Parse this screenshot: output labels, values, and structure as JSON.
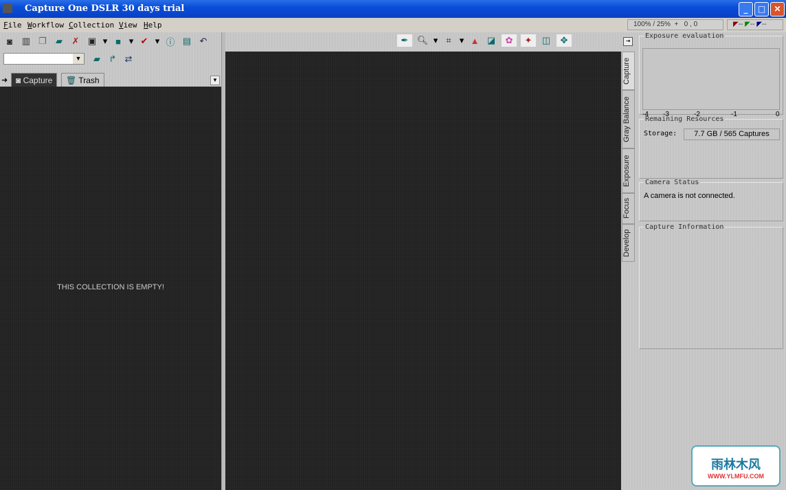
{
  "window": {
    "title": "Capture One DSLR 30 days trial"
  },
  "menu": [
    "File",
    "Workflow",
    "Collection",
    "View",
    "Help"
  ],
  "status": {
    "zoom": "100% / 25%",
    "coords": "0 , 0",
    "r": "--",
    "g": "--",
    "b": "--"
  },
  "left": {
    "tabs": [
      "Capture",
      "Trash"
    ],
    "empty_message": "THIS COLLECTION IS  EMPTY!",
    "collection_select": ""
  },
  "vertical_tabs": [
    "Capture",
    "Gray Balance",
    "Exposure",
    "Focus",
    "Develop"
  ],
  "right": {
    "exposure": {
      "title": "Exposure evaluation",
      "ticks": [
        "-4",
        "-3",
        "-2",
        "-1",
        "0"
      ]
    },
    "resources": {
      "title": "Remaining Resources",
      "storage_label": "Storage:",
      "storage_value": "7.7 GB / 565 Captures"
    },
    "camera": {
      "title": "Camera Status",
      "message": "A camera is not connected."
    },
    "info": {
      "title": "Capture Information"
    }
  },
  "watermark": {
    "logo_text": "雨林木风 WWW.YLMFU.COM"
  }
}
